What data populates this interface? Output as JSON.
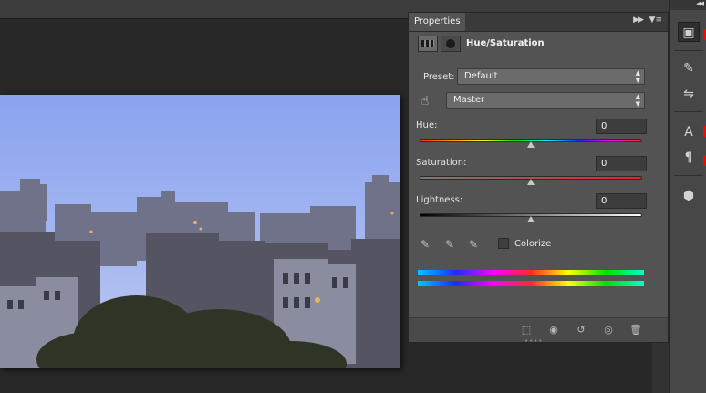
{
  "document": {},
  "panel": {
    "tab": "Properties",
    "adjustment_title": "Hue/Saturation",
    "preset_label": "Preset:",
    "preset_value": "Default",
    "channel_value": "Master",
    "hue_label": "Hue:",
    "hue_value": "0",
    "saturation_label": "Saturation:",
    "saturation_value": "0",
    "lightness_label": "Lightness:",
    "lightness_value": "0",
    "colorize_label": "Colorize",
    "colorize_checked": false
  },
  "icons": {
    "panel_menu": "panel-menu-icon",
    "collapse": "collapse-icon",
    "targeted_adjust": "hand-icon",
    "eyedroppers": [
      "eyedropper-icon",
      "eyedropper-plus-icon",
      "eyedropper-minus-icon"
    ],
    "bottom": [
      "clip-to-layer-icon",
      "view-previous-state-icon",
      "reset-icon",
      "visibility-icon",
      "delete-icon"
    ],
    "dock": [
      "properties-icon",
      "brush-tools-icon",
      "adjustments-icon",
      "character-icon",
      "paragraph-icon",
      "3d-icon"
    ]
  },
  "colors": {
    "panel_bg": "#535353",
    "dock_bg": "#474747",
    "canvas_bg": "#282828"
  }
}
